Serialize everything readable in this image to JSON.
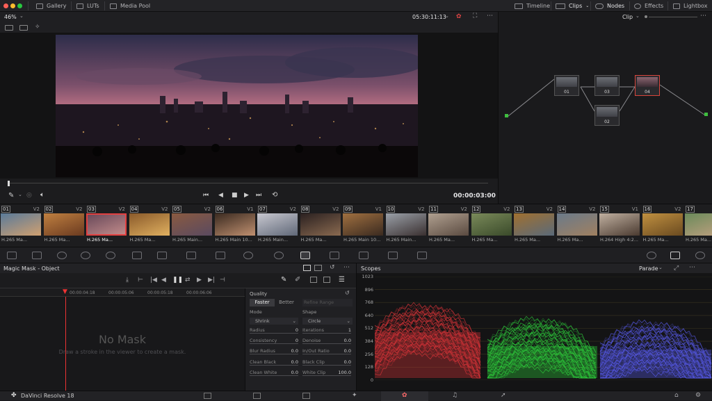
{
  "top_nav": {
    "gallery": "Gallery",
    "luts": "LUTs",
    "media_pool": "Media Pool",
    "timeline": "Timeline",
    "clips": "Clips",
    "nodes": "Nodes",
    "effects": "Effects",
    "lightbox": "Lightbox"
  },
  "viewer": {
    "zoom": "46%",
    "timecode": "05:30:11:13",
    "duration": "00:00:03:00",
    "progress": 0.0
  },
  "node_editor": {
    "mode": "Clip",
    "nodes": [
      {
        "label": "01"
      },
      {
        "label": "03"
      },
      {
        "label": "04"
      },
      {
        "label": "02"
      }
    ]
  },
  "clips": [
    {
      "num": "01",
      "track": "V2",
      "codec": "H.265 Ma..."
    },
    {
      "num": "02",
      "track": "V2",
      "codec": "H.265 Ma..."
    },
    {
      "num": "03",
      "track": "V2",
      "codec": "H.265 Ma..."
    },
    {
      "num": "04",
      "track": "V2",
      "codec": "H.265 Ma..."
    },
    {
      "num": "05",
      "track": "V2",
      "codec": "H.265 Main..."
    },
    {
      "num": "06",
      "track": "V1",
      "codec": "H.265 Main 10..."
    },
    {
      "num": "07",
      "track": "V2",
      "codec": "H.265 Main..."
    },
    {
      "num": "08",
      "track": "V2",
      "codec": "H.265 Ma..."
    },
    {
      "num": "09",
      "track": "V1",
      "codec": "H.265 Main 10..."
    },
    {
      "num": "10",
      "track": "V2",
      "codec": "H.265 Main..."
    },
    {
      "num": "11",
      "track": "V2",
      "codec": "H.265 Ma..."
    },
    {
      "num": "12",
      "track": "V2",
      "codec": "H.265 Ma..."
    },
    {
      "num": "13",
      "track": "V2",
      "codec": "H.265 Ma..."
    },
    {
      "num": "14",
      "track": "V2",
      "codec": "H.265 Ma..."
    },
    {
      "num": "15",
      "track": "V1",
      "codec": "H.264 High 4:2..."
    },
    {
      "num": "16",
      "track": "V2",
      "codec": "H.265 Ma..."
    },
    {
      "num": "17",
      "track": "V2",
      "codec": "H.265 Ma..."
    }
  ],
  "magic_mask": {
    "title": "Magic Mask - Object",
    "ruler": [
      "00:00:04:18",
      "00:00:05:06",
      "00:00:05:18",
      "00:00:06:06"
    ],
    "empty_title": "No Mask",
    "empty_hint": "Draw a stroke in the viewer to create a mask.",
    "quality_label": "Quality",
    "faster": "Faster",
    "better": "Better",
    "refine_range": "Refine Range",
    "mode_label": "Mode",
    "mode_value": "Shrink",
    "shape_label": "Shape",
    "shape_value": "Circle",
    "params_left": [
      {
        "name": "Radius",
        "value": "0"
      },
      {
        "name": "Consistency",
        "value": "0"
      },
      {
        "name": "Blur Radius",
        "value": "0.0"
      },
      {
        "name": "Clean Black",
        "value": "0.0"
      },
      {
        "name": "Clean White",
        "value": "0.0"
      }
    ],
    "params_right": [
      {
        "name": "Iterations",
        "value": "1"
      },
      {
        "name": "Denoise",
        "value": "0.0"
      },
      {
        "name": "In/Out Ratio",
        "value": "0.0"
      },
      {
        "name": "Black Clip",
        "value": "0.0"
      },
      {
        "name": "White Clip",
        "value": "100.0"
      }
    ]
  },
  "scopes": {
    "title": "Scopes",
    "mode": "Parade",
    "y_ticks": [
      "1023",
      "896",
      "768",
      "640",
      "512",
      "384",
      "256",
      "128",
      "0"
    ],
    "colors": {
      "red": "#e0353a",
      "green": "#2fd33d",
      "blue": "#5a5cf0"
    }
  },
  "app": {
    "name": "DaVinci Resolve 18"
  }
}
